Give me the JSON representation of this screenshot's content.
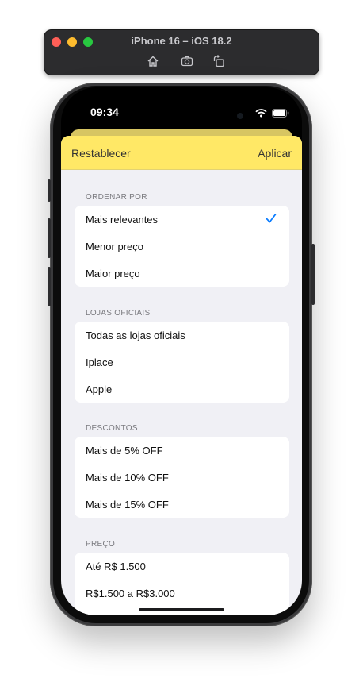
{
  "simulator": {
    "title": "iPhone 16 – iOS 18.2",
    "toolbar_icons": [
      "home-icon",
      "screenshot-icon",
      "rotate-icon"
    ]
  },
  "status_bar": {
    "time": "09:34"
  },
  "header": {
    "reset_label": "Restablecer",
    "apply_label": "Aplicar",
    "color": "#ffe866"
  },
  "sections": [
    {
      "title": "ORDENAR POR",
      "items": [
        "Mais relevantes",
        "Menor preço",
        "Maior preço"
      ],
      "selected": "Mais relevantes"
    },
    {
      "title": "LOJAS OFICIAIS",
      "items": [
        "Todas as lojas oficiais",
        "Iplace",
        "Apple"
      ]
    },
    {
      "title": "DESCONTOS",
      "items": [
        "Mais de 5% OFF",
        "Mais de 10% OFF",
        "Mais de 15% OFF"
      ]
    },
    {
      "title": "PREÇO",
      "items": [
        "Até R$ 1.500",
        "R$1.500 a R$3.000"
      ]
    }
  ],
  "colors": {
    "accent": "#0a7cff",
    "sheet_background": "#f0f0f5"
  }
}
